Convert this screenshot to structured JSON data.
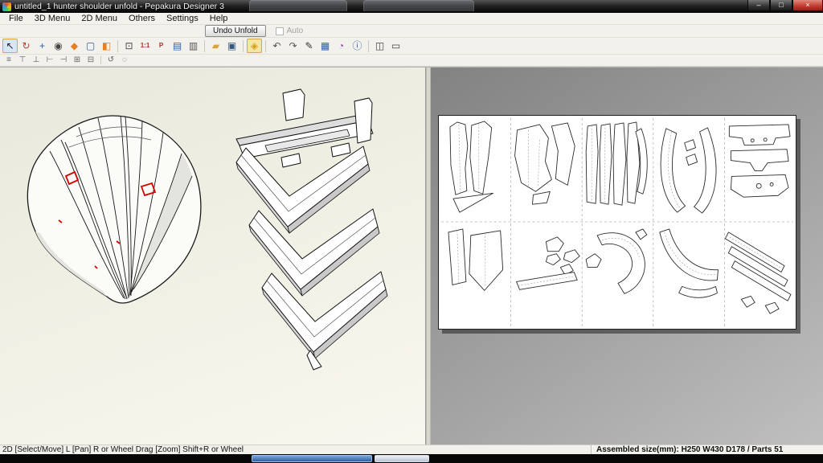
{
  "window": {
    "title": "untitled_1 hunter shoulder unfold - Pepakura Designer 3",
    "controls": {
      "minimize": "–",
      "maximize": "□",
      "close": "×"
    }
  },
  "menu": {
    "items": [
      "File",
      "3D Menu",
      "2D Menu",
      "Others",
      "Settings",
      "Help"
    ]
  },
  "unfold_bar": {
    "undo_button": "Undo Unfold",
    "auto_label": "Auto"
  },
  "toolbar": {
    "main_icons": [
      {
        "name": "select-tool",
        "glyph": "↖",
        "color": "#1a1a1a",
        "active": true
      },
      {
        "name": "rotate-tool",
        "glyph": "↻",
        "color": "#c0392b"
      },
      {
        "name": "pan-tool",
        "glyph": "+",
        "color": "#2e5fa3"
      },
      {
        "name": "zoom-tool",
        "glyph": "◉",
        "color": "#444444"
      },
      {
        "name": "edge-flag-tool",
        "glyph": "◆",
        "color": "#e67e22"
      },
      {
        "name": "box-select-tool",
        "glyph": "▢",
        "color": "#2e5fa3"
      },
      {
        "name": "divide-edge-tool",
        "glyph": "◧",
        "color": "#e67e22"
      },
      {
        "sep": true
      },
      {
        "name": "fit-view",
        "glyph": "⊡",
        "color": "#444444"
      },
      {
        "name": "zoom-one-to-one",
        "glyph": "1:1",
        "color": "#b03030",
        "small": true
      },
      {
        "name": "print-preview",
        "glyph": "P",
        "color": "#b03030",
        "small": true
      },
      {
        "name": "texture-display",
        "glyph": "▤",
        "color": "#2e5fa3"
      },
      {
        "name": "page-setup",
        "glyph": "▥",
        "color": "#555555"
      },
      {
        "sep": true
      },
      {
        "name": "open-file",
        "glyph": "▰",
        "color": "#d9a43b"
      },
      {
        "name": "save-file",
        "glyph": "▣",
        "color": "#34577d"
      },
      {
        "sep": true
      },
      {
        "name": "unfold",
        "glyph": "◈",
        "color": "#d4a017",
        "active_warm": true
      },
      {
        "sep": true
      },
      {
        "name": "undo",
        "glyph": "↶",
        "color": "#555555"
      },
      {
        "name": "redo",
        "glyph": "↷",
        "color": "#555555"
      },
      {
        "name": "pen-tool",
        "glyph": "✎",
        "color": "#333333"
      },
      {
        "name": "grid-display",
        "glyph": "▦",
        "color": "#2e5fa3"
      },
      {
        "name": "material-settings",
        "glyph": "◔",
        "color": "#8e44ad"
      },
      {
        "name": "info",
        "glyph": "ⓘ",
        "color": "#2e5fa3"
      },
      {
        "sep": true
      },
      {
        "name": "window-layout-split",
        "glyph": "◫",
        "color": "#444444"
      },
      {
        "name": "window-layout-single",
        "glyph": "▭",
        "color": "#444444"
      }
    ],
    "secondary_icons": [
      {
        "name": "arrange-parts",
        "glyph": "≡",
        "color": "#666666"
      },
      {
        "name": "align-top",
        "glyph": "⊤",
        "color": "#666666"
      },
      {
        "name": "align-bottom",
        "glyph": "⊥",
        "color": "#666666"
      },
      {
        "name": "align-left",
        "glyph": "⊢",
        "color": "#666666"
      },
      {
        "name": "align-right",
        "glyph": "⊣",
        "color": "#666666"
      },
      {
        "name": "distribute-parts",
        "glyph": "⊞",
        "color": "#666666"
      },
      {
        "name": "join-edges",
        "glyph": "⊟",
        "color": "#666666"
      },
      {
        "sep": true
      },
      {
        "name": "rotate-part",
        "glyph": "↺",
        "color": "#666666"
      },
      {
        "name": "check-parts",
        "glyph": "◌",
        "color": "#666666"
      }
    ]
  },
  "statusbar": {
    "left": "2D [Select/Move] L [Pan] R or Wheel Drag [Zoom] Shift+R or Wheel",
    "right": "Assembled size(mm): H250 W430 D178 / Parts 51"
  },
  "colors": {
    "titlebar": "#1c1c1c",
    "toolbar_bg": "#f2f1ec",
    "selection_accent": "#e0a23c",
    "pane3d_bg": "#f2f1e6",
    "pane2d_bg": "#9a9a9a",
    "page": "#ffffff",
    "red_edge_mark": "#d40000",
    "taskbar_item_active": "#2f5f9e"
  }
}
